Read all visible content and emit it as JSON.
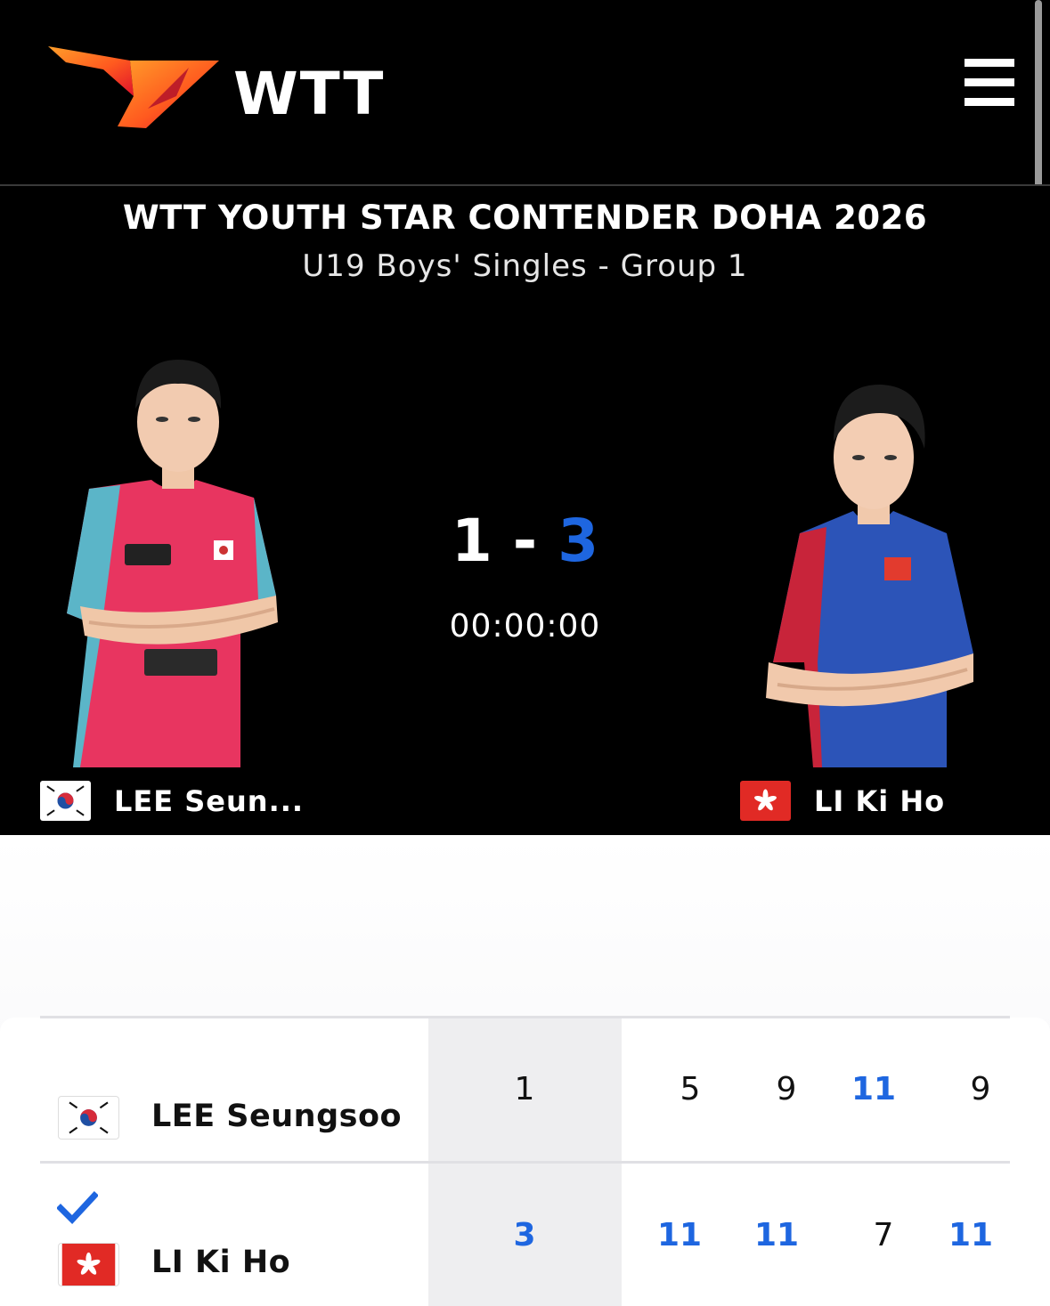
{
  "header": {
    "brand": "WTT",
    "logo_icon": "wtt-logo-icon",
    "menu_icon": "hamburger-menu-icon"
  },
  "event": {
    "title": "WTT YOUTH STAR CONTENDER DOHA 2026",
    "subtitle": "U19 Boys' Singles - Group 1"
  },
  "match": {
    "score_left": "1",
    "separator": "-",
    "score_right": "3",
    "timer": "00:00:00",
    "winner_color": "#1e66e0"
  },
  "players": {
    "left": {
      "short_name": "LEE Seun...",
      "full_name": "LEE Seungsoo",
      "flag": "south-korea-flag-icon",
      "games": "1",
      "winner": false
    },
    "right": {
      "short_name": "LI Ki Ho",
      "full_name": "LI Ki Ho",
      "flag": "hong-kong-flag-icon",
      "games": "3",
      "winner": true
    }
  },
  "games": {
    "left": [
      "5",
      "9",
      "11",
      "9"
    ],
    "right": [
      "11",
      "11",
      "7",
      "11"
    ]
  },
  "icons": {
    "winner_check": "check-icon"
  }
}
